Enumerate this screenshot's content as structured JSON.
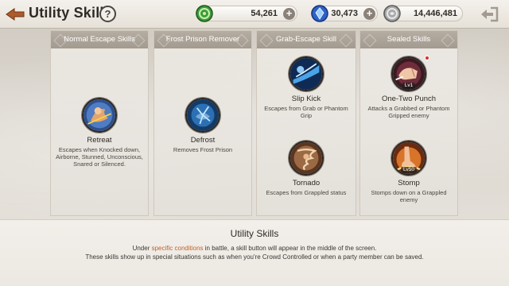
{
  "header": {
    "title": "Utility Skills",
    "help_label": "?",
    "currencies": [
      {
        "icon": "green-gold-coin-icon",
        "value": "54,261",
        "color": "#3f9b3a"
      },
      {
        "icon": "blue-gem-icon",
        "value": "30,473",
        "color": "#2f62c9"
      },
      {
        "icon": "silver-coin-icon",
        "value": "14,446,481",
        "color": "#8c8c8c"
      }
    ]
  },
  "columns": [
    {
      "title": "Normal Escape Skills",
      "skills": [
        {
          "name": "Retreat",
          "description": "Escapes when Knocked down, Airborne, Stunned, Unconscious, Snared or Silenced.",
          "icon": "retreat-skill-icon",
          "badge": ""
        }
      ]
    },
    {
      "title": "Frost Prison Remover",
      "skills": [
        {
          "name": "Defrost",
          "description": "Removes Frost Prison",
          "icon": "defrost-skill-icon",
          "badge": ""
        }
      ]
    },
    {
      "title": "Grab-Escape Skill",
      "skills": [
        {
          "name": "Slip Kick",
          "description": "Escapes from Grab or Phantom Grip",
          "icon": "slip-kick-skill-icon",
          "badge": ""
        },
        {
          "name": "Tornado",
          "description": "Escapes from Grappled status",
          "icon": "tornado-skill-icon",
          "badge": ""
        }
      ]
    },
    {
      "title": "Sealed Skills",
      "skills": [
        {
          "name": "One-Two Punch",
          "description": "Attacks a Grabbed or Phantom Gripped enemy",
          "icon": "one-two-punch-skill-icon",
          "badge": "Lv1"
        },
        {
          "name": "Stomp",
          "description": "Stomps down on a Grappled enemy",
          "icon": "stomp-skill-icon",
          "badge": "Lv50"
        }
      ]
    }
  ],
  "footer": {
    "title": "Utility Skills",
    "line1_before": "Under ",
    "line1_highlight": "specific conditions",
    "line1_after": " in battle, a skill button will appear in the middle of the screen.",
    "line2": "These skills show up in special situations such as when you're Crowd Controlled or when a party member can be saved.",
    "highlight_color": "#c0612b"
  }
}
